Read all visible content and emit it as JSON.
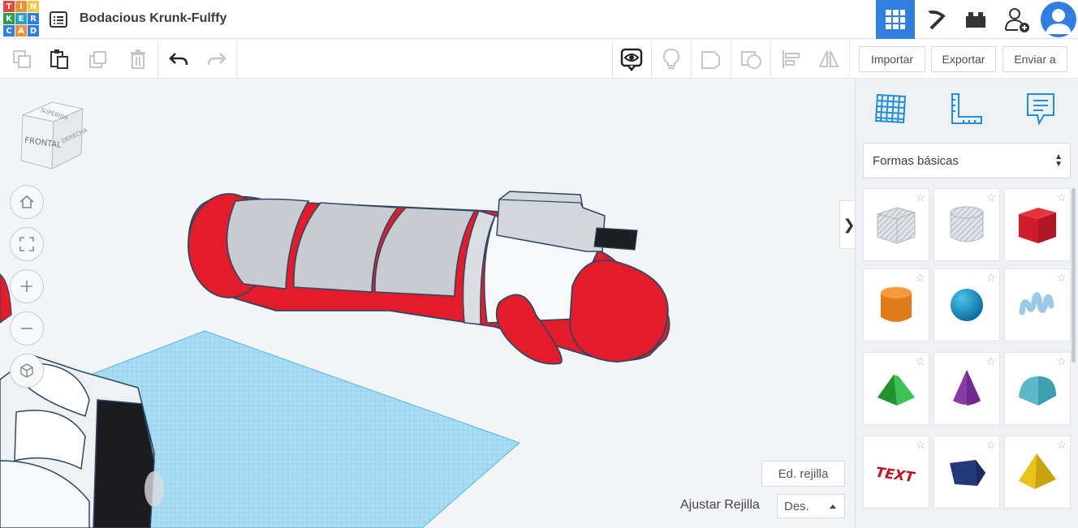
{
  "app": {
    "logo_letters": [
      "T",
      "I",
      "N",
      "K",
      "E",
      "R",
      "C",
      "A",
      "D"
    ],
    "logo_colors": [
      "#e8473b",
      "#f0913a",
      "#f6c343",
      "#2f9e4c",
      "#28a4c9",
      "#2f7ee0",
      "#2f7ee0",
      "#f0913a",
      "#2f7ee0"
    ],
    "document_title": "Bodacious Krunk-Fulffy"
  },
  "header": {
    "icons": [
      "design-view-grid-icon",
      "pickaxe-icon",
      "bricks-icon",
      "add-user-icon",
      "user-avatar"
    ]
  },
  "toolbar": {
    "tools": [
      "copy-icon",
      "paste-icon",
      "duplicate-icon",
      "delete-icon",
      "undo-icon",
      "redo-icon"
    ],
    "view_tools": [
      "show-all-icon",
      "light-bulb-icon",
      "group-shape-icon",
      "hole-shape-icon",
      "align-icon",
      "mirror-icon"
    ],
    "import_label": "Importar",
    "export_label": "Exportar",
    "send_label": "Enviar a"
  },
  "viewcube": {
    "top": "SUPERIOR",
    "front": "FRONTAL",
    "right": "DERECHA"
  },
  "workplane": {
    "edit_grid_label": "Ed. rejilla",
    "snap_grid_label": "Ajustar Rejilla",
    "snap_value": "Des.",
    "collapse_glyph": "❯"
  },
  "panel": {
    "tabs": [
      "workplane-icon",
      "ruler-icon",
      "notes-icon"
    ],
    "category": "Formas básicas",
    "shapes": [
      {
        "name": "Box hole"
      },
      {
        "name": "Cylinder hole"
      },
      {
        "name": "Box"
      },
      {
        "name": "Cylinder"
      },
      {
        "name": "Sphere"
      },
      {
        "name": "Scribble"
      },
      {
        "name": "Roof"
      },
      {
        "name": "Cone"
      },
      {
        "name": "Round Roof"
      },
      {
        "name": "Text"
      },
      {
        "name": "Polygon"
      },
      {
        "name": "Pyramid"
      }
    ],
    "text_shape_glyph": "TEXT",
    "star_glyph": "☆"
  },
  "colors": {
    "accent": "#2f7ee0",
    "red_shape": "#e31b2b",
    "grid_blue": "#8fd3ee"
  }
}
